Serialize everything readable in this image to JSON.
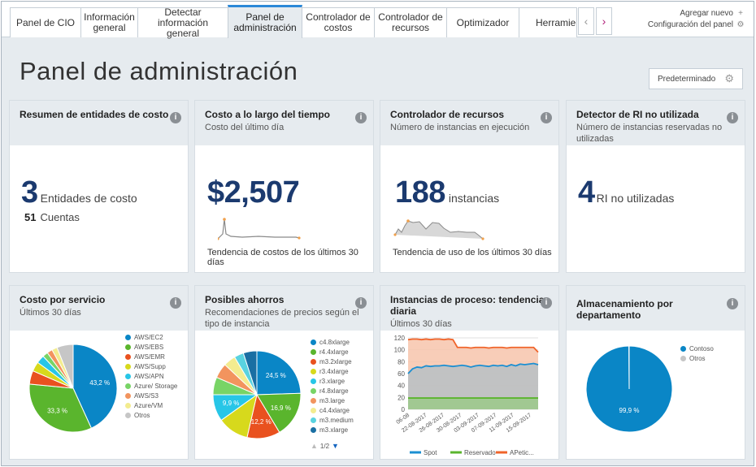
{
  "tabs": [
    {
      "label": "Panel de CIO"
    },
    {
      "label": "Información general"
    },
    {
      "label": "Detectar información general"
    },
    {
      "label": "Panel de administración"
    },
    {
      "label": "Controlador de costos"
    },
    {
      "label": "Controlador de recursos"
    },
    {
      "label": "Optimizador"
    },
    {
      "label": "Herramientas"
    }
  ],
  "tab_scroll": {
    "prev": "‹",
    "next": "›"
  },
  "toolbar": {
    "add_new": "Agregar nuevo",
    "panel_config": "Configuración del panel"
  },
  "page_title": "Panel de administración",
  "default_button": "Predeterminado",
  "cards": {
    "cost_entities": {
      "title": "Resumen de entidades de costo",
      "value": "3",
      "value_label": "Entidades de costo",
      "accounts_value": "51",
      "accounts_label": "Cuentas"
    },
    "cost_over_time": {
      "title": "Costo a lo largo del tiempo",
      "subtitle": "Costo del último día",
      "value": "$2,507",
      "trend_label": "Tendencia de costos de los últimos 30 días"
    },
    "resource_controller": {
      "title": "Controlador de recursos",
      "subtitle": "Número de instancias en ejecución",
      "value": "188",
      "value_label": "instancias",
      "trend_label": "Tendencia de uso de los últimos 30 días"
    },
    "ri_detector": {
      "title": "Detector de RI no utilizada",
      "subtitle": "Número de instancias reservadas no utilizadas",
      "value": "4",
      "value_label": "RI no utilizadas"
    },
    "cost_by_service": {
      "title": "Costo por servicio",
      "subtitle": "Últimos 30 días"
    },
    "savings": {
      "title": "Posibles ahorros",
      "subtitle": "Recomendaciones de precios según el tipo de instancia",
      "pager": "1/2"
    },
    "compute_instances": {
      "title": "Instancias de proceso: tendencia diaria",
      "subtitle": "Últimos 30 días"
    },
    "storage_by_dept": {
      "title": "Almacenamiento por departamento"
    }
  },
  "chart_data": [
    {
      "type": "pie",
      "title": "Costo por servicio",
      "categories": [
        "AWS/EC2",
        "AWS/EBS",
        "AWS/EMR",
        "AWS/Supp",
        "AWS/APN",
        "Azure/ Storage",
        "AWS/S3",
        "Azure/VM",
        "Otros"
      ],
      "values": [
        43.2,
        33.3,
        5.0,
        3.5,
        3.0,
        2.0,
        2.0,
        2.0,
        6.0
      ],
      "labels": [
        "43,2 %",
        "33,3 %",
        "",
        "",
        "",
        "",
        "",
        "",
        ""
      ],
      "colors": [
        "#0a86c6",
        "#5ab52d",
        "#e9511f",
        "#d7d91c",
        "#27c6e7",
        "#78d466",
        "#f2945e",
        "#f3ec8f",
        "#c6c6c6"
      ]
    },
    {
      "type": "pie",
      "title": "Posibles ahorros",
      "categories": [
        "c4.8xlarge",
        "r4.4xlarge",
        "m3.2xlarge",
        "r3.4xlarge",
        "r3.xlarge",
        "r4.8xlarge",
        "m3.large",
        "c4.4xlarge",
        "m3.medium",
        "m3.xlarge"
      ],
      "values": [
        24.5,
        16.9,
        12.2,
        11.5,
        9.9,
        6.5,
        5.5,
        4.5,
        3.5,
        5.0
      ],
      "labels": [
        "24,5 %",
        "16,9 %",
        "12,2 %",
        "",
        "9,9 %",
        "",
        "",
        "",
        "",
        ""
      ],
      "colors": [
        "#0a86c6",
        "#5ab52d",
        "#e9511f",
        "#d7d91c",
        "#27c6e7",
        "#78d466",
        "#f2945e",
        "#f3ec8f",
        "#59d3e0",
        "#1a6fa3"
      ]
    },
    {
      "type": "area",
      "title": "Instancias de proceso: tendencia diaria",
      "x": [
        "06-08",
        "22-08-2017",
        "26-08-2017",
        "30-08-2017",
        "03-09-2017",
        "07-09-2017",
        "11-09-2017",
        "15-09-2017"
      ],
      "ylim": [
        0,
        120
      ],
      "yticks": [
        0,
        20,
        40,
        60,
        80,
        100,
        120
      ],
      "series": [
        {
          "name": "Spot",
          "color": "#1b8fd2",
          "values": [
            60,
            68,
            71,
            70,
            73,
            72,
            73,
            73,
            74,
            73,
            72,
            73,
            74,
            73,
            71,
            73,
            74,
            73,
            72,
            74,
            73,
            74,
            72,
            75,
            73,
            76,
            75,
            76,
            77,
            75
          ]
        },
        {
          "name": "Reservado",
          "color": "#5ab52d",
          "values": [
            19,
            19,
            19,
            19,
            19,
            19,
            19,
            19,
            19,
            19,
            19,
            19,
            19,
            19,
            19,
            19,
            19,
            19,
            19,
            19,
            19,
            19,
            19,
            19,
            19,
            19,
            19,
            19,
            19,
            19
          ]
        },
        {
          "name": "APetic...",
          "color": "#f0642a",
          "values": [
            117,
            118,
            118,
            117,
            118,
            117,
            118,
            118,
            117,
            118,
            117,
            104,
            104,
            104,
            103,
            104,
            104,
            104,
            103,
            104,
            104,
            104,
            103,
            104,
            104,
            104,
            104,
            104,
            104,
            96
          ]
        }
      ]
    },
    {
      "type": "pie",
      "title": "Almacenamiento por departamento",
      "categories": [
        "Contoso",
        "Otros"
      ],
      "values": [
        99.9,
        0.1
      ],
      "labels": [
        "99,9 %",
        ""
      ],
      "colors": [
        "#0a86c6",
        "#c6c6c6"
      ]
    }
  ]
}
